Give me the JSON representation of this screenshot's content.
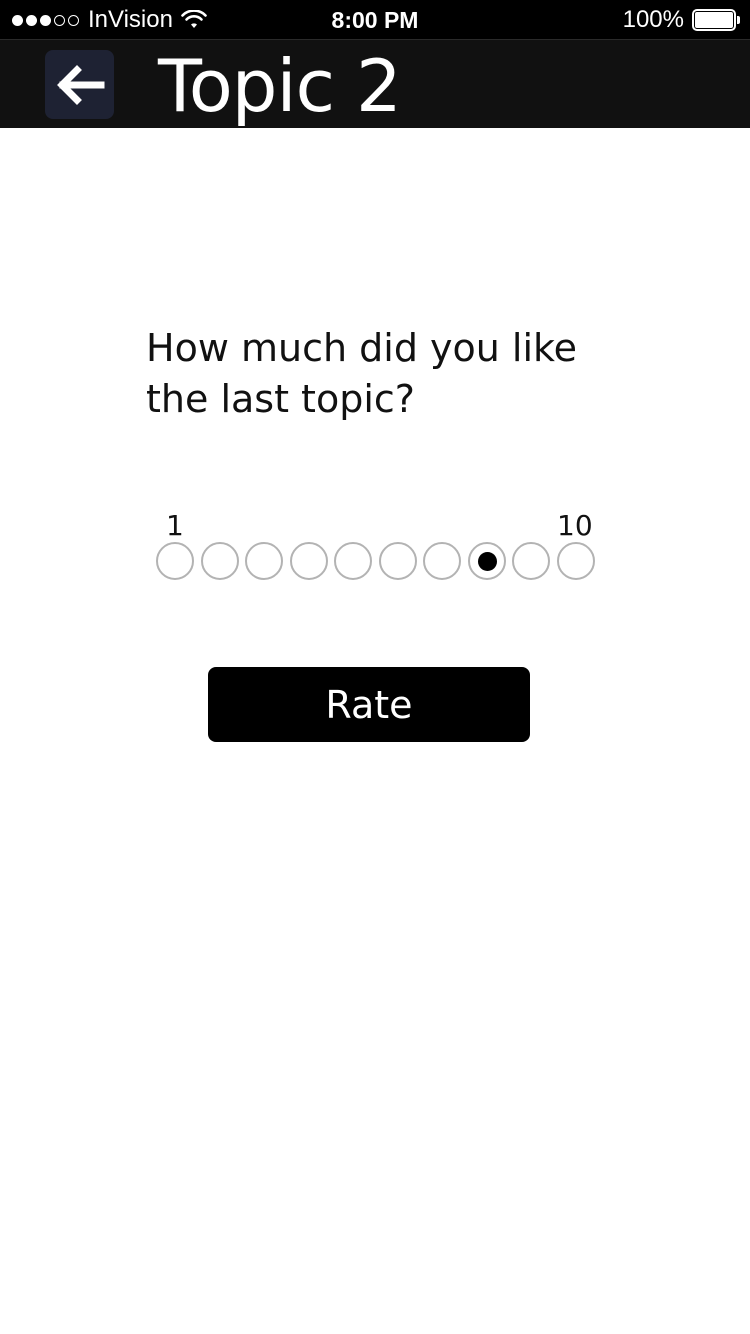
{
  "status_bar": {
    "carrier": "InVision",
    "signal_bars_filled": 3,
    "signal_bars_total": 5,
    "time": "8:00 PM",
    "battery": "100%",
    "icons": [
      "signal-dots-icon",
      "wifi-icon",
      "battery-icon"
    ]
  },
  "header": {
    "back_icon": "arrow-left-icon",
    "title": "Topic 2",
    "colors": {
      "bar_background": "#111111",
      "back_button_background": "#1e2233"
    }
  },
  "question": {
    "text": "How much did you like the last topic?"
  },
  "rating": {
    "min_label": "1",
    "max_label": "10",
    "options": [
      1,
      2,
      3,
      4,
      5,
      6,
      7,
      8,
      9,
      10
    ],
    "selected": 8
  },
  "rate_button": {
    "label": "Rate",
    "background": "#000000"
  }
}
